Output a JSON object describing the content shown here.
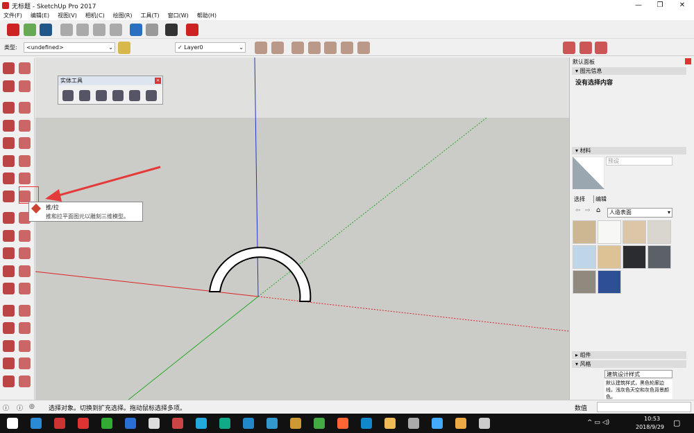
{
  "window": {
    "title": "无标题 - SketchUp Pro 2017",
    "minimize": "—",
    "restore": "❐",
    "close": "✕"
  },
  "menu": [
    "文件(F)",
    "编辑(E)",
    "视图(V)",
    "相机(C)",
    "绘图(R)",
    "工具(T)",
    "窗口(W)",
    "帮助(H)"
  ],
  "toolbar": {
    "icons": [
      {
        "name": "new-icon",
        "color": "#c22"
      },
      {
        "name": "open-icon",
        "color": "#6a5"
      },
      {
        "name": "save-icon",
        "color": "#258"
      },
      {
        "name": "cut-icon",
        "color": "#aaa"
      },
      {
        "name": "copy-icon",
        "color": "#aaa"
      },
      {
        "name": "paste-icon",
        "color": "#aaa"
      },
      {
        "name": "erase-icon",
        "color": "#aaa"
      },
      {
        "name": "undo-icon",
        "color": "#2a6fc0"
      },
      {
        "name": "redo-icon",
        "color": "#999"
      },
      {
        "name": "print-icon",
        "color": "#333"
      },
      {
        "name": "model-info-icon",
        "color": "#c22"
      }
    ]
  },
  "toolbar2": {
    "type_label": "类型:",
    "type_value": "<undefined>",
    "layer_check": "✓",
    "layer_value": "Layer0"
  },
  "solid_tools": {
    "title": "实体工具",
    "close": "×"
  },
  "tooltip": {
    "title": "推/拉",
    "desc": "推和拉平面图元以雕刻三维模型。"
  },
  "panel": {
    "title": "默认面板",
    "entity_info": "图元信息",
    "no_selection": "没有选择内容",
    "materials": "材料",
    "material_name": "预设",
    "tab_select": "选择",
    "tab_edit": "编辑",
    "collection": "人造表面",
    "components": "组件",
    "styles": "风格",
    "style_name": "建筑设计样式",
    "style_desc": "默认建筑样式，黑色轮廓边线，浅灰色天空和灰色背景颜色。",
    "swatches": [
      "#cdb792",
      "#f7f7f5",
      "#dcc6a8",
      "#d9d6d0",
      "#bfd6e8",
      "#dcc294",
      "#2a2c30",
      "#5b6166",
      "#8f8a7d",
      "#2f4f94"
    ]
  },
  "status": {
    "text": "选择对象。切换到扩充选择。拖动鼠标选择多项。",
    "measure_label": "数值"
  },
  "taskbar": {
    "time": "10:53",
    "date": "2018/9/29"
  },
  "colors": {
    "red_axis": "#d22",
    "green_axis": "#2a2",
    "blue_axis": "#22c",
    "sky": "#e0e0de",
    "ground": "#cbcbc7",
    "arrow": "#e53a3a"
  }
}
